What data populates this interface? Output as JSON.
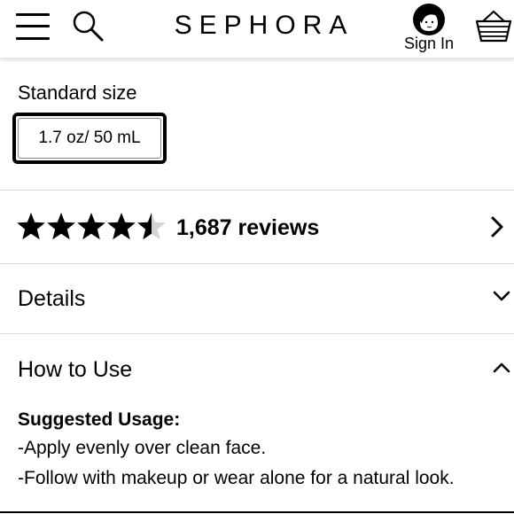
{
  "header": {
    "logo_text": "SEPHORA",
    "signin_label": "Sign In",
    "icons": [
      "menu-icon",
      "search-icon",
      "user-avatar-icon",
      "basket-icon"
    ]
  },
  "size": {
    "title": "Standard size",
    "selected_option": "1.7 oz/ 50 mL"
  },
  "reviews": {
    "rating": 4.5,
    "max_rating": 5,
    "count_label": "1,687 reviews"
  },
  "details": {
    "label": "Details",
    "expanded": false
  },
  "how_to_use": {
    "label": "How to Use",
    "expanded": true,
    "heading": "Suggested Usage:",
    "lines": [
      "-Apply evenly over clean face.",
      "-Follow with makeup or wear alone for a natural look."
    ]
  },
  "colors": {
    "text": "#000000",
    "star_filled": "#000000",
    "star_empty": "#d4d4d4",
    "divider": "#dedede"
  }
}
